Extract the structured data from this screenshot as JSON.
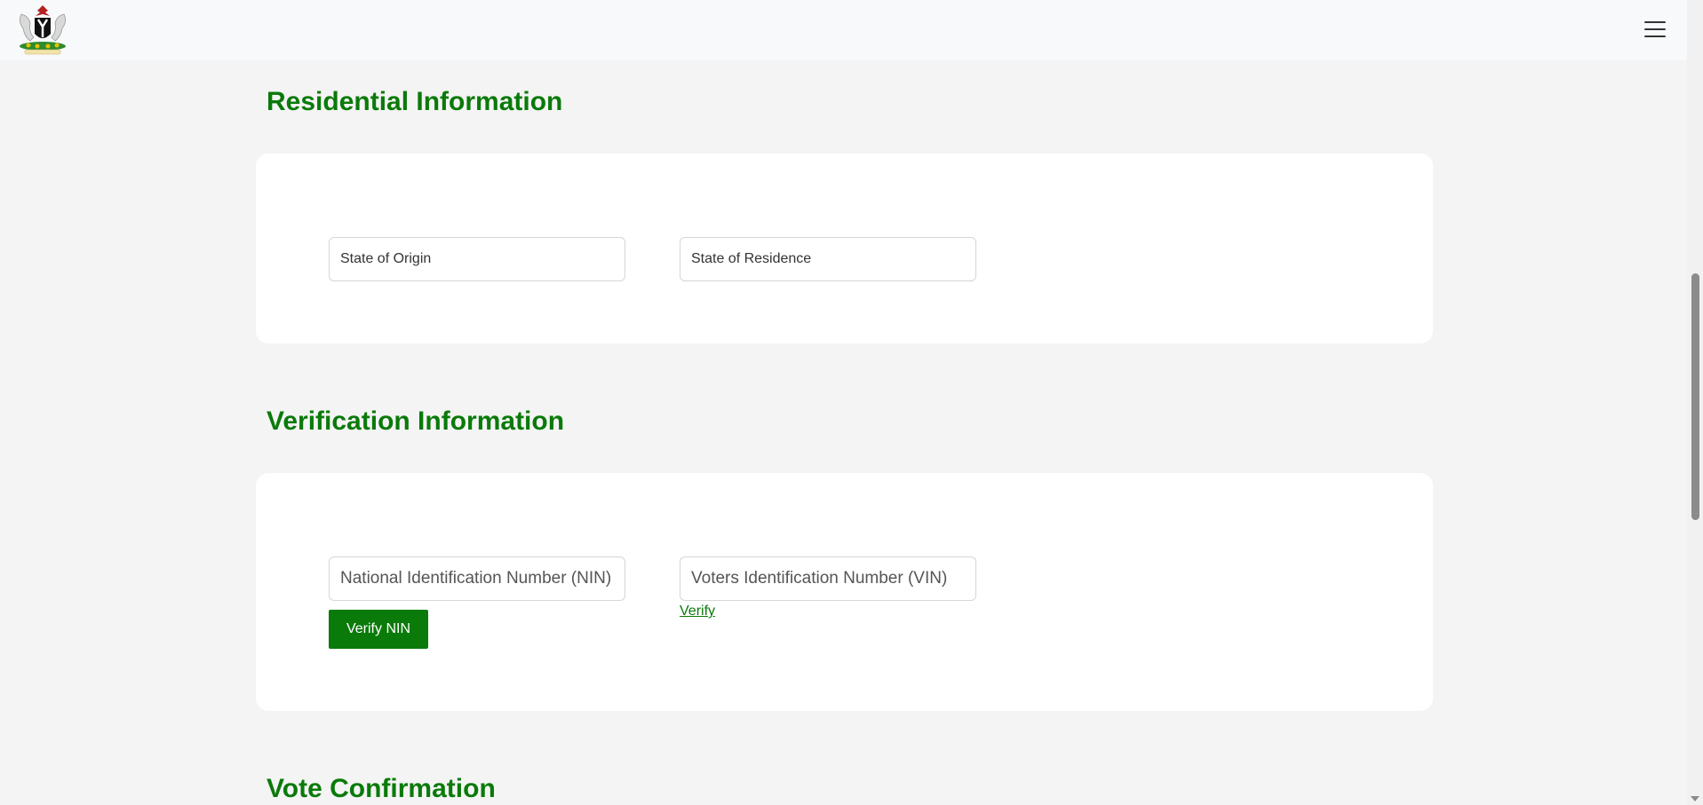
{
  "header": {
    "logo_icon": "nigeria-coat-of-arms-icon",
    "menu_icon": "hamburger-menu-icon"
  },
  "residential": {
    "title": "Residential Information",
    "state_of_origin": "State of Origin",
    "state_of_residence": "State of Residence"
  },
  "verification": {
    "title": "Verification Information",
    "nin_placeholder": "National Identification Number (NIN)",
    "vin_placeholder": "Voters Identification Number (VIN)",
    "verify_nin_label": "Verify NIN",
    "verify_link_label": "Verify"
  },
  "vote": {
    "title": "Vote Confirmation"
  },
  "colors": {
    "accent": "#0a7a0a",
    "page_bg": "#f4f4f4",
    "card_bg": "#ffffff"
  }
}
